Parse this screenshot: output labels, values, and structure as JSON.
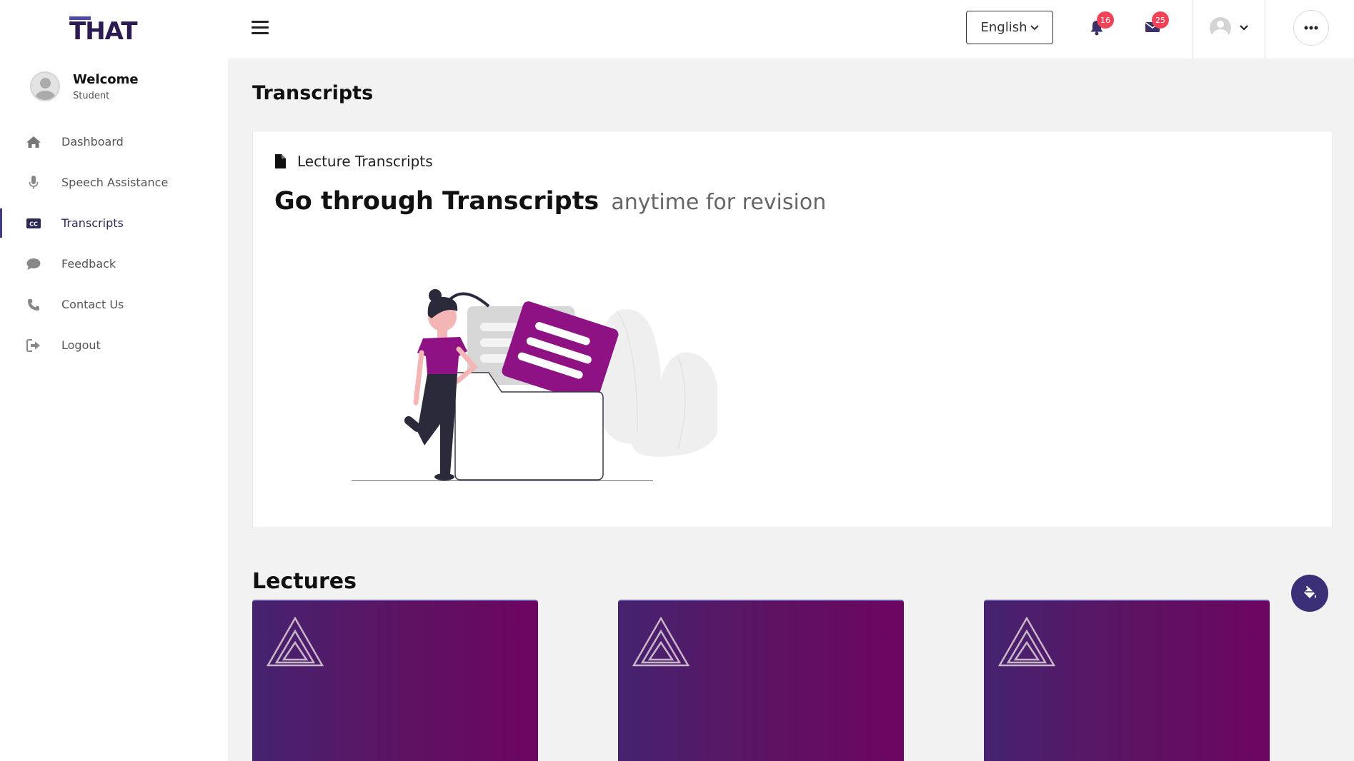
{
  "app": {
    "logo_text": "THAT"
  },
  "sidebar": {
    "welcome_title": "Welcome",
    "welcome_role": "Student",
    "items": [
      {
        "label": "Dashboard",
        "icon": "home-icon"
      },
      {
        "label": "Speech Assistance",
        "icon": "microphone-icon"
      },
      {
        "label": "Transcripts",
        "icon": "closed-captions-icon",
        "active": true
      },
      {
        "label": "Feedback",
        "icon": "chat-bubble-icon"
      },
      {
        "label": "Contact Us",
        "icon": "phone-icon"
      },
      {
        "label": "Logout",
        "icon": "logout-icon"
      }
    ]
  },
  "header": {
    "language": "English",
    "notifications_count": "16",
    "messages_count": "25"
  },
  "main": {
    "page_title": "Transcripts",
    "card": {
      "label": "Lecture Transcripts",
      "headline_bold": "Go through Transcripts",
      "headline_rest": "anytime for revision"
    },
    "lectures_title": "Lectures",
    "lecture_cards": 3
  },
  "colors": {
    "brand": "#2c1a52",
    "accent": "#3f3a85",
    "badge": "#f0435a",
    "illustration_purple": "#8e1284",
    "card_gradient_start": "#452370",
    "card_gradient_end": "#6d0562"
  }
}
